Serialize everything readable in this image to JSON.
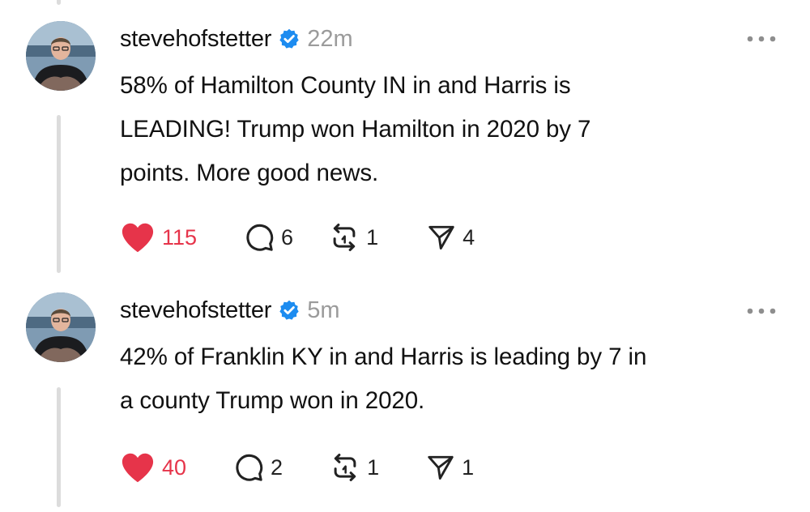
{
  "colors": {
    "like": "#e6344a",
    "verified": "#1d8cf0",
    "time": "#9b9b9b",
    "thread_line": "#dcdcdc"
  },
  "posts": [
    {
      "username": "stevehofstetter",
      "verified": true,
      "time": "22m",
      "text_lines": [
        "58% of Hamilton County IN in and Harris is",
        "LEADING! Trump won Hamilton in 2020 by 7",
        "points. More good news."
      ],
      "likes": "115",
      "liked": true,
      "replies": "6",
      "reposts": "1",
      "shares": "4"
    },
    {
      "username": "stevehofstetter",
      "verified": true,
      "time": "5m",
      "text_lines": [
        "42% of Franklin KY in and Harris is leading by 7 in",
        "a county Trump won in 2020."
      ],
      "likes": "40",
      "liked": true,
      "replies": "2",
      "reposts": "1",
      "shares": "1"
    }
  ],
  "icons": {
    "like": "heart-icon",
    "reply": "comment-icon",
    "repost": "repost-icon",
    "share": "send-icon",
    "verified": "verified-badge-icon",
    "more": "more-options-icon"
  }
}
